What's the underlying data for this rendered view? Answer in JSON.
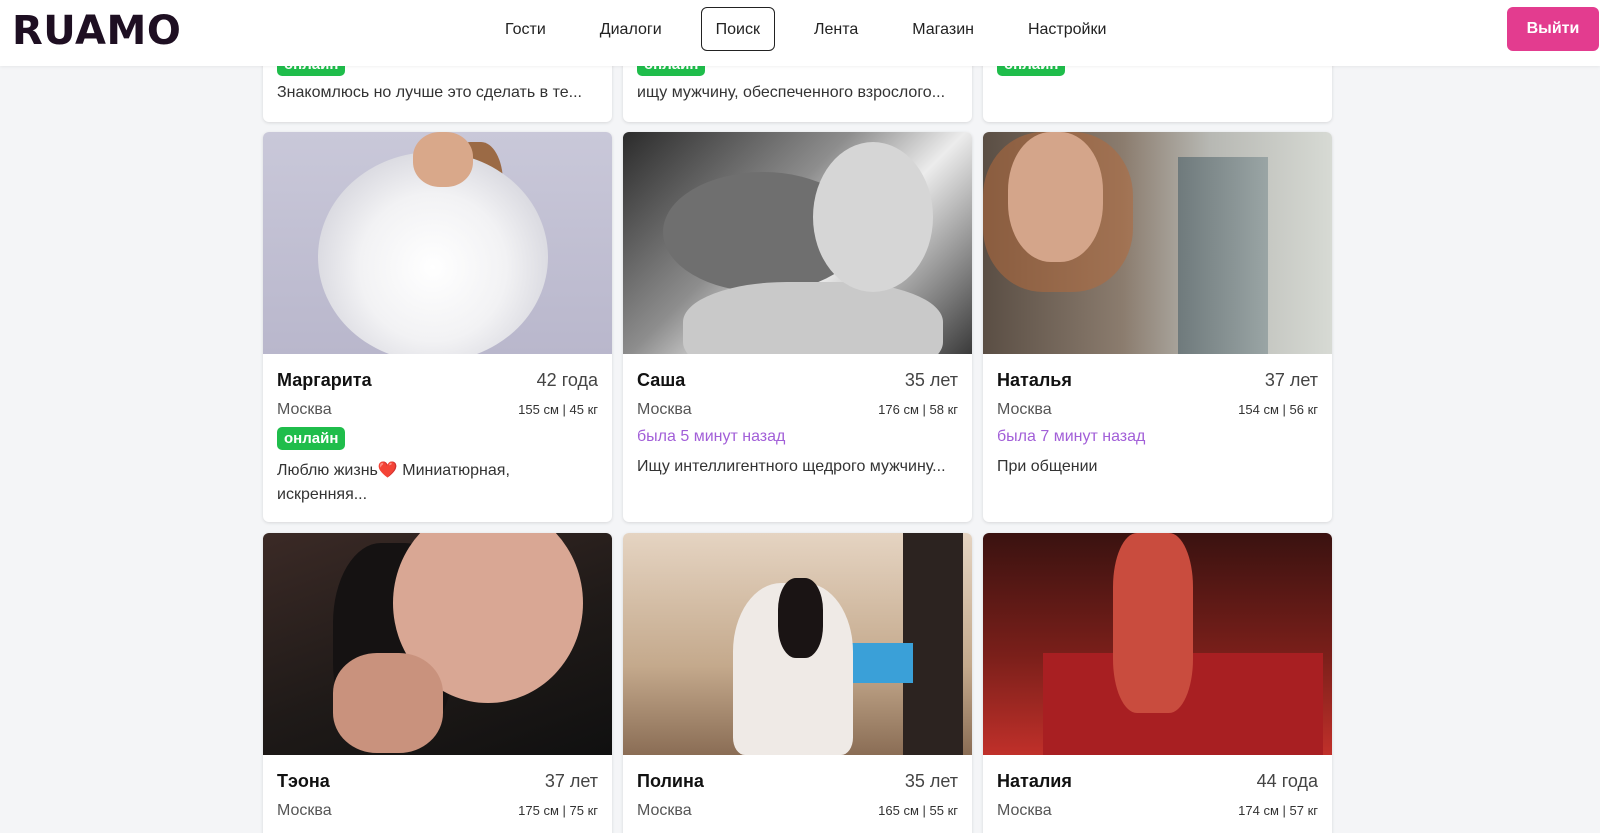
{
  "header": {
    "logo": "RUAMO",
    "nav": [
      "Гости",
      "Диалоги",
      "Поиск",
      "Лента",
      "Магазин",
      "Настройки"
    ],
    "active_nav": "Поиск",
    "logout_label": "Выйти"
  },
  "top_cards": [
    {
      "badge": "онлайн",
      "about": "Знакомлюсь но лучше это сделать в те..."
    },
    {
      "badge": "онлайн",
      "about": "ищу мужчину, обеспеченного взрослого..."
    },
    {
      "badge": "онлайн",
      "about": ""
    }
  ],
  "profiles": [
    {
      "name": "Маргарита",
      "age": "42 года",
      "city": "Москва",
      "size": "155 см | 45 кг",
      "badge": "онлайн",
      "about": "Люблю жизнь",
      "heart": "❤️",
      "about2": " Миниатюрная, искренняя..."
    },
    {
      "name": "Саша",
      "age": "35 лет",
      "city": "Москва",
      "size": "176 см | 58 кг",
      "status": "была 5 минут назад",
      "about": "Ищу интеллигентного щедрого мужчину..."
    },
    {
      "name": "Наталья",
      "age": "37 лет",
      "city": "Москва",
      "size": "154 см | 56 кг",
      "status": "была 7 минут назад",
      "about": "При общении"
    },
    {
      "name": "Тэона",
      "age": "37 лет",
      "city": "Москва",
      "size": "175 см | 75 кг"
    },
    {
      "name": "Полина",
      "age": "35 лет",
      "city": "Москва",
      "size": "165 см | 55 кг"
    },
    {
      "name": "Наталия",
      "age": "44 года",
      "city": "Москва",
      "size": "174 см | 57 кг"
    }
  ],
  "colors": {
    "accent": "#e33c8f",
    "online": "#1fbd4b",
    "status": "#a25fd8"
  }
}
